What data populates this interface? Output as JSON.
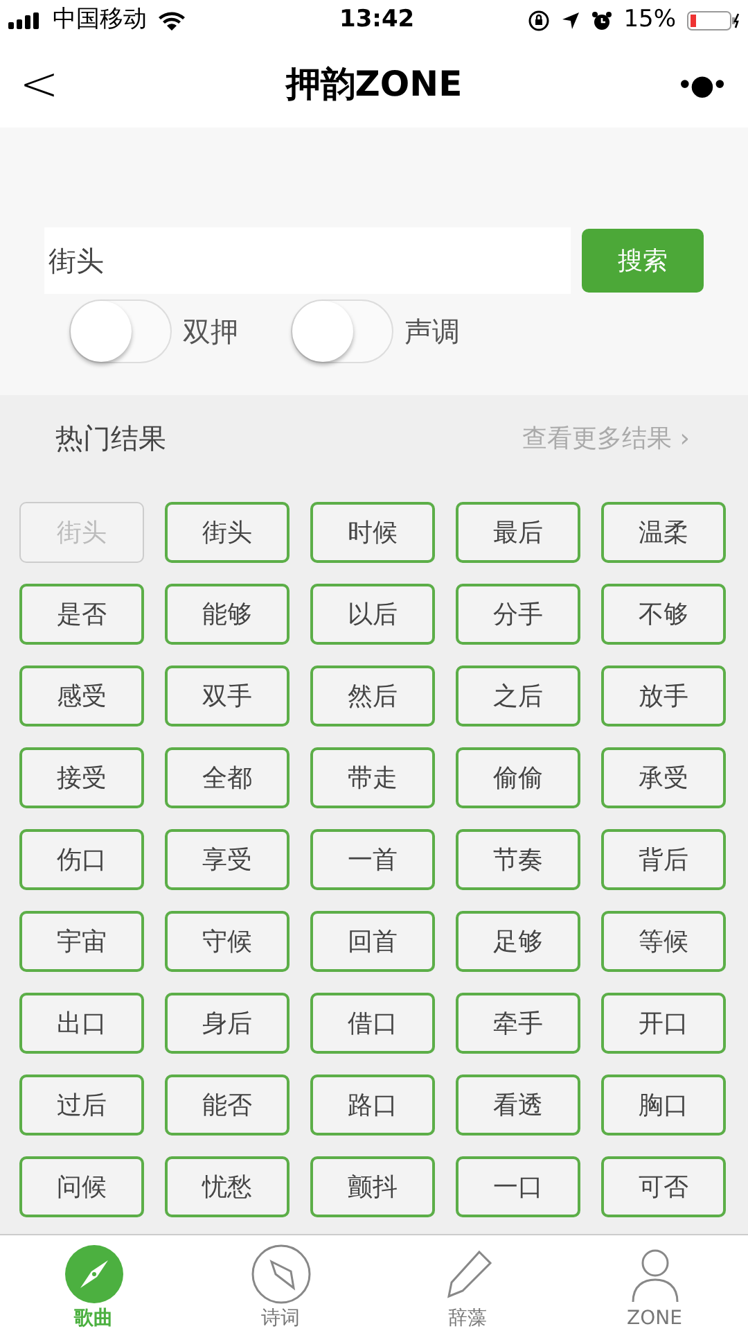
{
  "status_bar": {
    "carrier": "中国移动",
    "time": "13:42",
    "battery": "15%"
  },
  "nav": {
    "back": "<",
    "title": "押韵ZONE",
    "more": "•●•"
  },
  "search": {
    "value": "街头",
    "button": "搜索"
  },
  "toggles": [
    {
      "label": "双押",
      "on": false
    },
    {
      "label": "声调",
      "on": false
    }
  ],
  "results": {
    "title": "热门结果",
    "more": "查看更多结果 ›",
    "words": [
      {
        "text": "街头",
        "disabled": true
      },
      {
        "text": "街头",
        "disabled": false
      },
      {
        "text": "时候",
        "disabled": false
      },
      {
        "text": "最后",
        "disabled": false
      },
      {
        "text": "温柔",
        "disabled": false
      },
      {
        "text": "是否",
        "disabled": false
      },
      {
        "text": "能够",
        "disabled": false
      },
      {
        "text": "以后",
        "disabled": false
      },
      {
        "text": "分手",
        "disabled": false
      },
      {
        "text": "不够",
        "disabled": false
      },
      {
        "text": "感受",
        "disabled": false
      },
      {
        "text": "双手",
        "disabled": false
      },
      {
        "text": "然后",
        "disabled": false
      },
      {
        "text": "之后",
        "disabled": false
      },
      {
        "text": "放手",
        "disabled": false
      },
      {
        "text": "接受",
        "disabled": false
      },
      {
        "text": "全都",
        "disabled": false
      },
      {
        "text": "带走",
        "disabled": false
      },
      {
        "text": "偷偷",
        "disabled": false
      },
      {
        "text": "承受",
        "disabled": false
      },
      {
        "text": "伤口",
        "disabled": false
      },
      {
        "text": "享受",
        "disabled": false
      },
      {
        "text": "一首",
        "disabled": false
      },
      {
        "text": "节奏",
        "disabled": false
      },
      {
        "text": "背后",
        "disabled": false
      },
      {
        "text": "宇宙",
        "disabled": false
      },
      {
        "text": "守候",
        "disabled": false
      },
      {
        "text": "回首",
        "disabled": false
      },
      {
        "text": "足够",
        "disabled": false
      },
      {
        "text": "等候",
        "disabled": false
      },
      {
        "text": "出口",
        "disabled": false
      },
      {
        "text": "身后",
        "disabled": false
      },
      {
        "text": "借口",
        "disabled": false
      },
      {
        "text": "牵手",
        "disabled": false
      },
      {
        "text": "开口",
        "disabled": false
      },
      {
        "text": "过后",
        "disabled": false
      },
      {
        "text": "能否",
        "disabled": false
      },
      {
        "text": "路口",
        "disabled": false
      },
      {
        "text": "看透",
        "disabled": false
      },
      {
        "text": "胸口",
        "disabled": false
      },
      {
        "text": "问候",
        "disabled": false
      },
      {
        "text": "忧愁",
        "disabled": false
      },
      {
        "text": "颤抖",
        "disabled": false
      },
      {
        "text": "一口",
        "disabled": false
      },
      {
        "text": "可否",
        "disabled": false
      }
    ]
  },
  "tab_bar": [
    {
      "label": "歌曲",
      "kind": "compass-filled",
      "selected": true
    },
    {
      "label": "诗词",
      "kind": "compass",
      "selected": false
    },
    {
      "label": "辞藻",
      "kind": "pencil",
      "selected": false
    },
    {
      "label": "ZONE",
      "kind": "person",
      "selected": false
    }
  ]
}
